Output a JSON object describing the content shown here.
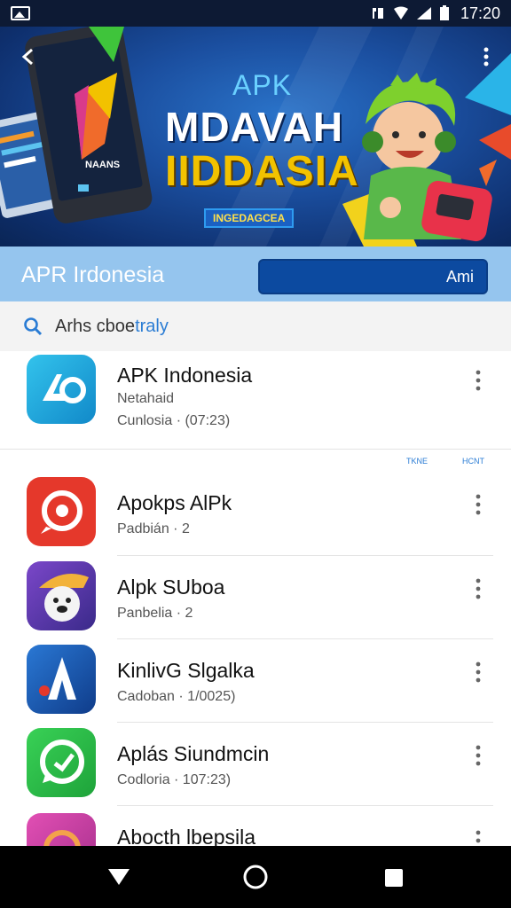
{
  "status_bar": {
    "icons": [
      "image-icon",
      "notification-icon",
      "wifi-icon",
      "signal-icon",
      "battery-icon"
    ],
    "time": "17:20"
  },
  "banner": {
    "small_title": "APK",
    "line1": "MDAVAH",
    "line2": "IIDDASIA",
    "badge": "INGEDAGCEA",
    "phone_label": "NAANS"
  },
  "header": {
    "title": "APR  Irdonesia",
    "button_label": "Ami"
  },
  "search": {
    "text_main": "Arhs cboe",
    "text_accent": "traly"
  },
  "mini_labels": [
    "TKNE",
    "HCNT"
  ],
  "apps": [
    {
      "name": "APK Indonesia",
      "sub1": "Netahaid",
      "sub2": "Cunlosia ·  (07:23)",
      "icon": "apk-indonesia-icon",
      "color": "#1aa3d6"
    },
    {
      "name": "Apokps AlPk",
      "sub1": "Padbián ·  2",
      "sub2": "",
      "icon": "apokps-icon",
      "color": "#e5382b"
    },
    {
      "name": "Alpk SUboa",
      "sub1": "Panbelia ·  2",
      "sub2": "",
      "icon": "alpk-suboa-icon",
      "color": "#5b3fa8"
    },
    {
      "name": "KinlivG Slgalka",
      "sub1": "Cadoban ·  1/0025)",
      "sub2": "",
      "icon": "kinlivg-icon",
      "color": "#1d5fb5"
    },
    {
      "name": "Aplás Siundmcin",
      "sub1": "Codloria ·  107:23)",
      "sub2": "",
      "icon": "aplas-icon",
      "color": "#2cbf4a"
    },
    {
      "name": "Abocth lbepsila",
      "sub1": "",
      "sub2": "",
      "icon": "abocth-icon",
      "color": "#d83fa8"
    }
  ],
  "nav": {
    "icons": [
      "back-triangle-icon",
      "home-circle-icon",
      "recents-square-icon"
    ]
  }
}
